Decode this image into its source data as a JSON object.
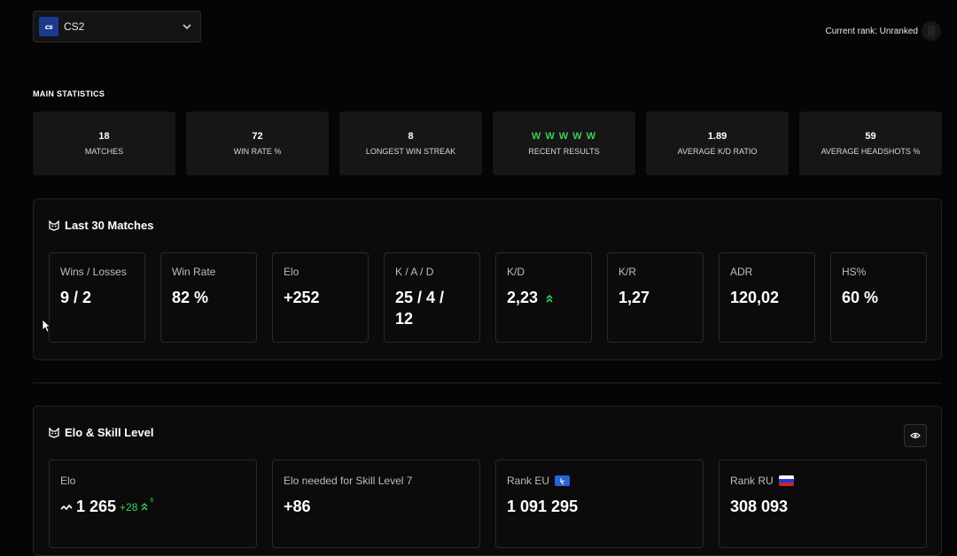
{
  "header": {
    "game_logo_text": "cs",
    "game_name": "CS2",
    "rank_text": "Current rank: Unranked"
  },
  "main_statistics": {
    "title": "MAIN STATISTICS",
    "cards": [
      {
        "value": "18",
        "label": "MATCHES"
      },
      {
        "value": "72",
        "label": "WIN RATE %"
      },
      {
        "value": "8",
        "label": "LONGEST WIN STREAK"
      },
      {
        "value": "W W W W W",
        "label": "RECENT RESULTS"
      },
      {
        "value": "1.89",
        "label": "AVERAGE K/D RATIO"
      },
      {
        "value": "59",
        "label": "AVERAGE HEADSHOTS %"
      }
    ]
  },
  "last_matches": {
    "title": "Last 30 Matches",
    "cards": [
      {
        "label": "Wins / Losses",
        "value": "9 / 2"
      },
      {
        "label": "Win Rate",
        "value": "82 %"
      },
      {
        "label": "Elo",
        "value": "+252"
      },
      {
        "label": "K / A / D",
        "value": "25 / 4 / 12"
      },
      {
        "label": "K/D",
        "value": "2,23"
      },
      {
        "label": "K/R",
        "value": "1,27"
      },
      {
        "label": "ADR",
        "value": "120,02"
      },
      {
        "label": "HS%",
        "value": "60 %"
      }
    ]
  },
  "elo_skill": {
    "title": "Elo & Skill Level",
    "cards": [
      {
        "label": "Elo",
        "value": "1 265",
        "delta": "+28",
        "delta_sup": "6"
      },
      {
        "label": "Elo needed for Skill Level 7",
        "value": "+86"
      },
      {
        "label": "Rank EU",
        "value": "1 091 295"
      },
      {
        "label": "Rank RU",
        "value": "308 093"
      }
    ]
  },
  "colors": {
    "accent_green": "#3ad157",
    "background": "#050505",
    "card": "#161616"
  }
}
